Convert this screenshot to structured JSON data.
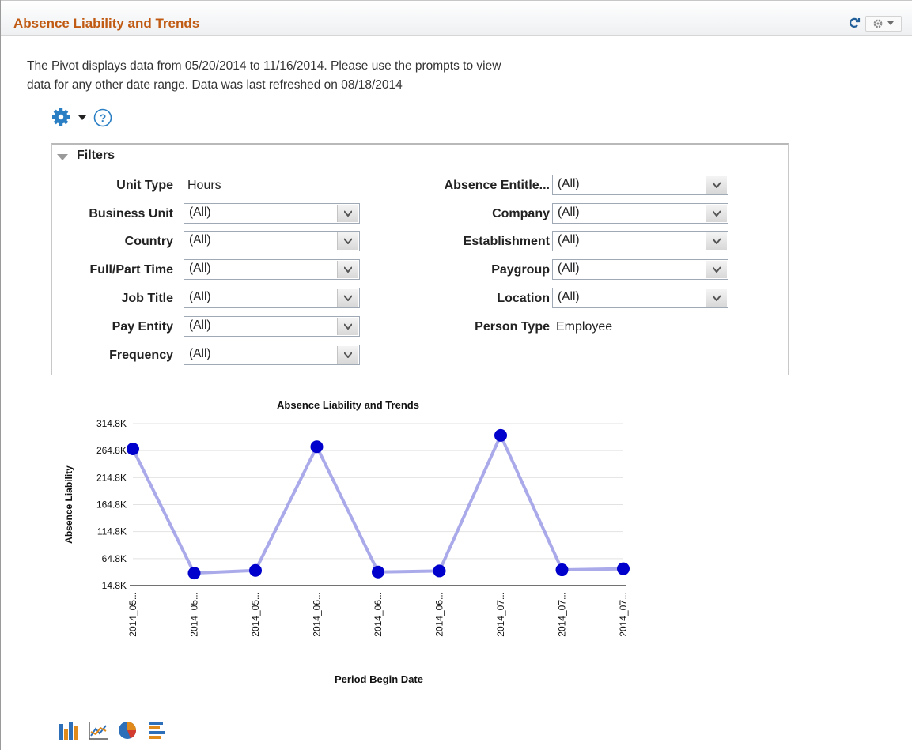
{
  "header": {
    "title": "Absence Liability and Trends",
    "refresh_icon": "refresh-icon",
    "settings_icon": "gear-dropdown-icon"
  },
  "description": {
    "line1": "The Pivot displays data from 05/20/2014 to 11/16/2014. Please use the prompts to view",
    "line2": "data for any other date range. Data was last refreshed on 08/18/2014"
  },
  "toolbar": {
    "options_icon": "gear-icon",
    "help_icon": "help-icon"
  },
  "filters": {
    "title": "Filters",
    "left": [
      {
        "label": "Unit Type",
        "type": "text",
        "value": "Hours"
      },
      {
        "label": "Business Unit",
        "type": "select",
        "value": "(All)"
      },
      {
        "label": "Country",
        "type": "select",
        "value": "(All)"
      },
      {
        "label": "Full/Part Time",
        "type": "select",
        "value": "(All)"
      },
      {
        "label": "Job Title",
        "type": "select",
        "value": "(All)"
      },
      {
        "label": "Pay Entity",
        "type": "select",
        "value": "(All)"
      },
      {
        "label": "Frequency",
        "type": "select",
        "value": "(All)"
      }
    ],
    "right": [
      {
        "label": "Absence Entitle...",
        "type": "select",
        "value": "(All)"
      },
      {
        "label": "Company",
        "type": "select",
        "value": "(All)"
      },
      {
        "label": "Establishment",
        "type": "select",
        "value": "(All)"
      },
      {
        "label": "Paygroup",
        "type": "select",
        "value": "(All)"
      },
      {
        "label": "Location",
        "type": "select",
        "value": "(All)"
      },
      {
        "label": "Person Type",
        "type": "text",
        "value": "Employee"
      }
    ]
  },
  "chart_data": {
    "type": "line",
    "title": "Absence Liability and Trends",
    "xlabel": "Period Begin Date",
    "ylabel": "Absence Liability",
    "categories": [
      "2014_05...",
      "2014_05...",
      "2014_05...",
      "2014_06...",
      "2014_06...",
      "2014_06...",
      "2014_07...",
      "2014_07...",
      "2014_07..."
    ],
    "series": [
      {
        "values": [
          268000,
          38000,
          43000,
          272000,
          40000,
          42000,
          293000,
          44000,
          46000
        ]
      }
    ],
    "yticks": [
      "314.8K",
      "264.8K",
      "214.8K",
      "164.8K",
      "114.8K",
      "64.8K",
      "14.8K"
    ],
    "ylim": [
      14800,
      314800
    ],
    "grid": true,
    "colors": {
      "line": "#9b9be6",
      "marker": "#0000cc"
    }
  },
  "chart_type_icons": [
    "bar-chart-icon",
    "line-chart-icon",
    "pie-chart-icon",
    "horizontal-bar-chart-icon"
  ]
}
